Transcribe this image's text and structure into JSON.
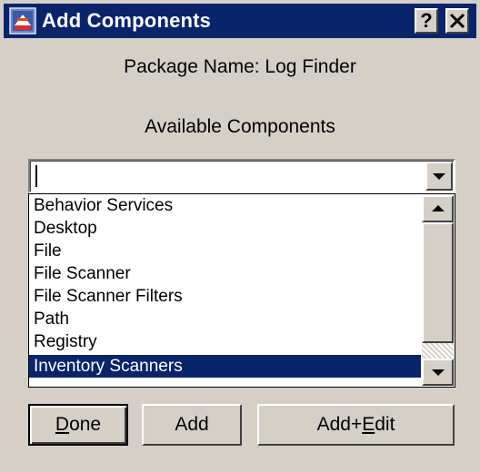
{
  "window": {
    "title": "Add Components",
    "help_glyph": "?",
    "close_glyph": "✕"
  },
  "package_label": "Package Name: Log Finder",
  "available_label": "Available Components",
  "combo": {
    "value": ""
  },
  "list": {
    "items": [
      "Behavior Services",
      "Desktop",
      "File",
      "File Scanner",
      "File Scanner Filters",
      "Path",
      "Registry",
      "Inventory Scanners"
    ],
    "selected": "Inventory Scanners"
  },
  "buttons": {
    "done": {
      "mnemonic": "D",
      "rest": "one"
    },
    "add": "Add",
    "addedit": {
      "before": "Add+",
      "mnemonic": "E",
      "rest": "dit"
    }
  },
  "colors": {
    "titlebar": "#0a246a",
    "selection": "#0a246a",
    "face": "#d4d0c8"
  }
}
